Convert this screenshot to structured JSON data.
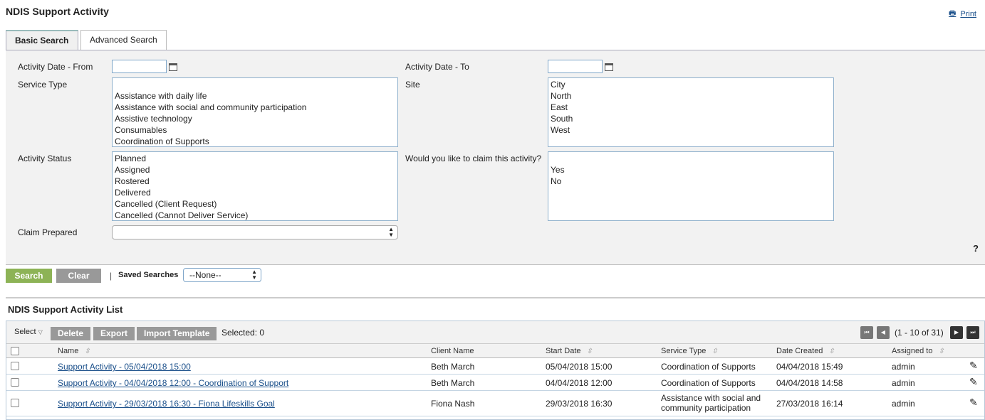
{
  "page": {
    "title": "NDIS Support Activity",
    "print": "Print",
    "help": "?"
  },
  "tabs": [
    {
      "label": "Basic Search"
    },
    {
      "label": "Advanced Search"
    }
  ],
  "form": {
    "date_from": {
      "label": "Activity Date - From",
      "value": ""
    },
    "date_to": {
      "label": "Activity Date - To",
      "value": ""
    },
    "service_type": {
      "label": "Service Type",
      "options": [
        "",
        "Assistance with daily life",
        "Assistance with social and community participation",
        "Assistive technology",
        "Consumables",
        "Coordination of Supports"
      ]
    },
    "site": {
      "label": "Site",
      "options": [
        "City",
        "North",
        "East",
        "South",
        "West"
      ]
    },
    "activity_status": {
      "label": "Activity Status",
      "options": [
        "Planned",
        "Assigned",
        "Rostered",
        "Delivered",
        "Cancelled (Client Request)",
        "Cancelled (Cannot Deliver Service)"
      ]
    },
    "claim": {
      "label": "Would you like to claim this activity?",
      "options": [
        "",
        "Yes",
        "No"
      ]
    },
    "claim_prepared": {
      "label": "Claim Prepared",
      "value": ""
    }
  },
  "actions": {
    "search": "Search",
    "clear": "Clear",
    "separator": "|",
    "saved_label": "Saved Searches",
    "saved_value": "--None--"
  },
  "list": {
    "title": "NDIS Support Activity List",
    "select": "Select",
    "delete": "Delete",
    "export": "Export",
    "import": "Import Template",
    "selected": "Selected: 0",
    "pagination": "(1 - 10 of 31)",
    "columns": [
      "Name",
      "Client Name",
      "Start Date",
      "Service Type",
      "Date Created",
      "Assigned to"
    ],
    "rows": [
      {
        "name": "Support Activity - 05/04/2018 15:00",
        "client": "Beth March",
        "start": "05/04/2018 15:00",
        "service": "Coordination of Supports",
        "created": "04/04/2018 15:49",
        "assigned": "admin"
      },
      {
        "name": "Support Activity - 04/04/2018 12:00 - Coordination of Support",
        "client": "Beth March",
        "start": "04/04/2018 12:00",
        "service": "Coordination of Supports",
        "created": "04/04/2018 14:58",
        "assigned": "admin"
      },
      {
        "name": "Support Activity - 29/03/2018 16:30 - Fiona Lifeskills Goal",
        "client": "Fiona Nash",
        "start": "29/03/2018 16:30",
        "service": "Assistance with social and community participation",
        "created": "27/03/2018 16:14",
        "assigned": "admin"
      }
    ]
  }
}
